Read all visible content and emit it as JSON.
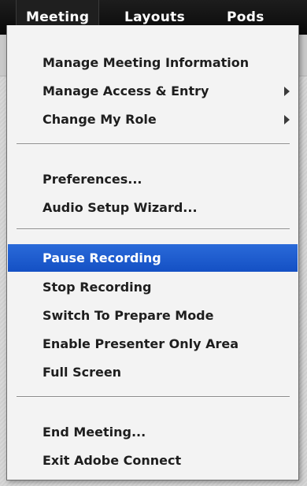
{
  "menubar": {
    "items": [
      {
        "label": "Meeting"
      },
      {
        "label": "Layouts"
      },
      {
        "label": "Pods"
      }
    ]
  },
  "menu": {
    "items": [
      {
        "label": "Manage Meeting Information"
      },
      {
        "label": "Manage Access & Entry"
      },
      {
        "label": "Change My Role"
      },
      {
        "label": "Preferences..."
      },
      {
        "label": "Audio Setup Wizard..."
      },
      {
        "label": "Pause Recording"
      },
      {
        "label": "Stop Recording"
      },
      {
        "label": "Switch To Prepare Mode"
      },
      {
        "label": "Enable Presenter Only Area"
      },
      {
        "label": "Full Screen"
      },
      {
        "label": "End Meeting..."
      },
      {
        "label": "Exit Adobe Connect"
      }
    ]
  },
  "colors": {
    "menubar_bg": "#111111",
    "highlight": "#1a5ccf",
    "menu_bg": "#f3f3f3"
  },
  "icons": {
    "submenu": "chevron-right-icon"
  }
}
